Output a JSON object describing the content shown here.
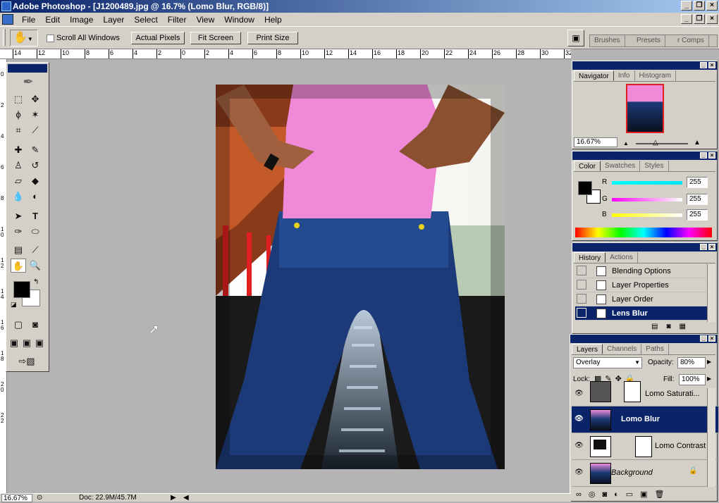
{
  "window": {
    "title": "Adobe Photoshop - [J1200489.jpg @ 16.7% (Lomo Blur, RGB/8)]"
  },
  "menu": [
    "File",
    "Edit",
    "Image",
    "Layer",
    "Select",
    "Filter",
    "View",
    "Window",
    "Help"
  ],
  "options": {
    "scroll_all_label": "Scroll All Windows",
    "actual_pixels": "Actual Pixels",
    "fit_screen": "Fit Screen",
    "print_size": "Print Size",
    "well_tabs": [
      "Brushes",
      "Presets",
      "r Comps"
    ]
  },
  "ruler_h": [
    "14",
    "12",
    "10",
    "8",
    "6",
    "4",
    "2",
    "0",
    "2",
    "4",
    "6",
    "8",
    "10",
    "12",
    "14",
    "16",
    "18",
    "20",
    "22",
    "24",
    "26",
    "28",
    "30",
    "32"
  ],
  "ruler_v": [
    "0",
    "2",
    "4",
    "6",
    "8",
    "1 0",
    "1 2",
    "1 4",
    "1 6",
    "1 8",
    "2 0",
    "2 2"
  ],
  "navigator": {
    "tabs": [
      "Navigator",
      "Info",
      "Histogram"
    ],
    "zoom": "16.67%"
  },
  "color": {
    "tabs": [
      "Color",
      "Swatches",
      "Styles"
    ],
    "channels": [
      {
        "label": "R",
        "value": "255",
        "color": "#00e5ff"
      },
      {
        "label": "G",
        "value": "255",
        "color": "#ff00ff"
      },
      {
        "label": "B",
        "value": "255",
        "color": "#ffff00"
      }
    ]
  },
  "history": {
    "tabs": [
      "History",
      "Actions"
    ],
    "items": [
      "Blending Options",
      "Layer Properties",
      "Layer Order",
      "Lens Blur"
    ],
    "selected": "Lens Blur"
  },
  "layers": {
    "tabs": [
      "Layers",
      "Channels",
      "Paths"
    ],
    "blend_mode": "Overlay",
    "opacity_label": "Opacity:",
    "opacity": "80%",
    "lock_label": "Lock:",
    "fill_label": "Fill:",
    "fill": "100%",
    "items": [
      "Lomo Saturati...",
      "Lomo Blur",
      "Lomo Contrast",
      "Background"
    ],
    "selected": "Lomo Blur"
  },
  "status": {
    "zoom": "16.67%",
    "doc": "Doc: 22.9M/45.7M"
  }
}
